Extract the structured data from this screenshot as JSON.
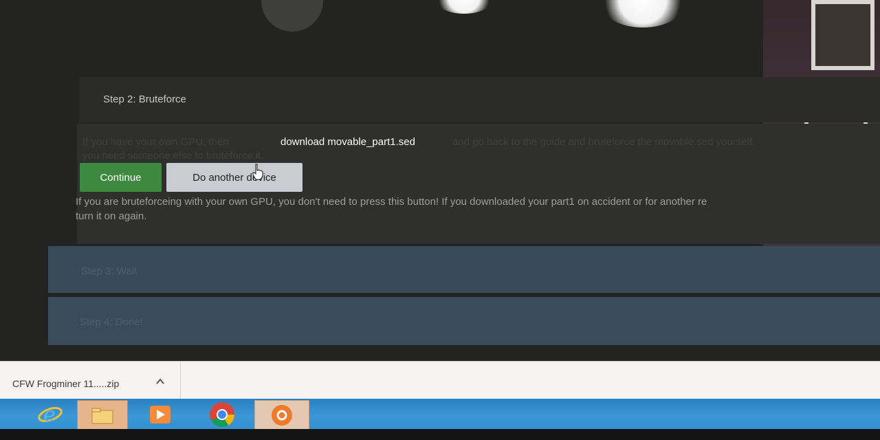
{
  "step2": {
    "title": "Step 2: Bruteforce",
    "intro_prefix": "If you have your own GPU, then",
    "download_link": "download movable_part1.sed",
    "intro_suffix": "and go back to the guide and bruteforce the movable.sed yourself.",
    "intro_line2": "you need someone else to bruteforce it.",
    "continue_label": "Continue",
    "another_device_label": "Do another device",
    "notice": "If you are bruteforceing with your own GPU, you don't need to press this button! If you downloaded your part1 on accident or for another re",
    "notice_line2": "turn it on again."
  },
  "step3": {
    "label": "Step 3: Wait"
  },
  "step4": {
    "label": "Step 4: Done!"
  },
  "download_bar": {
    "file_name": "CFW Frogminer 11.....zip"
  },
  "taskbar": {
    "items": [
      "internet-explorer-icon",
      "file-explorer-icon",
      "media-player-icon",
      "chrome-icon",
      "orange-app-icon"
    ]
  },
  "colors": {
    "continue_green": "#3d8a3f",
    "collapsed_step_blue": "#394a5c",
    "taskbar_blue": "#2f8ccd"
  }
}
